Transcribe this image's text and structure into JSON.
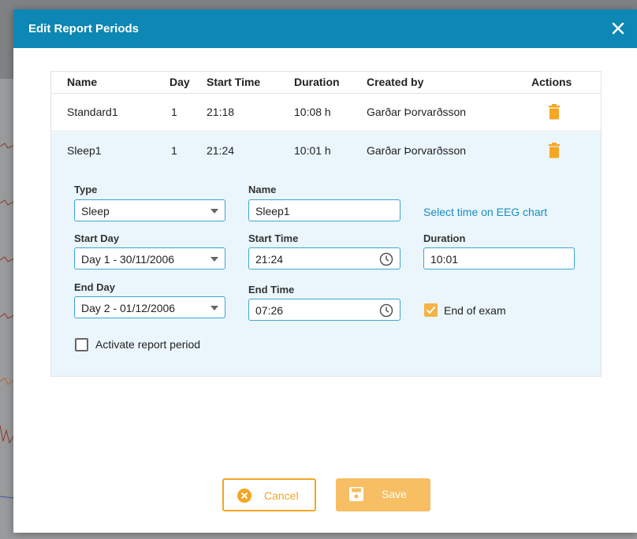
{
  "dialog": {
    "title": "Edit Report Periods"
  },
  "table": {
    "headers": {
      "name": "Name",
      "day": "Day",
      "start_time": "Start Time",
      "duration": "Duration",
      "created_by": "Created by",
      "actions": "Actions"
    },
    "rows": [
      {
        "name": "Standard1",
        "day": "1",
        "start_time": "21:18",
        "duration": "10:08 h",
        "created_by": "Garðar Þorvarðsson"
      },
      {
        "name": "Sleep1",
        "day": "1",
        "start_time": "21:24",
        "duration": "10:01 h",
        "created_by": "Garðar Þorvarðsson"
      }
    ]
  },
  "form": {
    "type_label": "Type",
    "type_value": "Sleep",
    "name_label": "Name",
    "name_value": "Sleep1",
    "select_eeg_link": "Select time on EEG chart",
    "start_day_label": "Start Day",
    "start_day_value": "Day 1 - 30/11/2006",
    "start_time_label": "Start Time",
    "start_time_value": "21:24",
    "duration_label": "Duration",
    "duration_value": "10:01",
    "end_day_label": "End Day",
    "end_day_value": "Day 2 - 01/12/2006",
    "end_time_label": "End Time",
    "end_time_value": "07:26",
    "end_of_exam_label": "End of exam",
    "end_of_exam_checked": true,
    "activate_label": "Activate report period",
    "activate_checked": false
  },
  "buttons": {
    "cancel": "Cancel",
    "save": "Save"
  },
  "colors": {
    "header": "#0d87b3",
    "accent": "#f5a623",
    "selected_row": "#eaf6fc",
    "link": "#1a8cbf"
  },
  "icons": {
    "close": "close-icon",
    "delete": "trash-icon",
    "clock": "clock-icon",
    "cancel": "cancel-circle-icon",
    "save": "floppy-disk-icon",
    "dropdown": "caret-down-icon"
  }
}
